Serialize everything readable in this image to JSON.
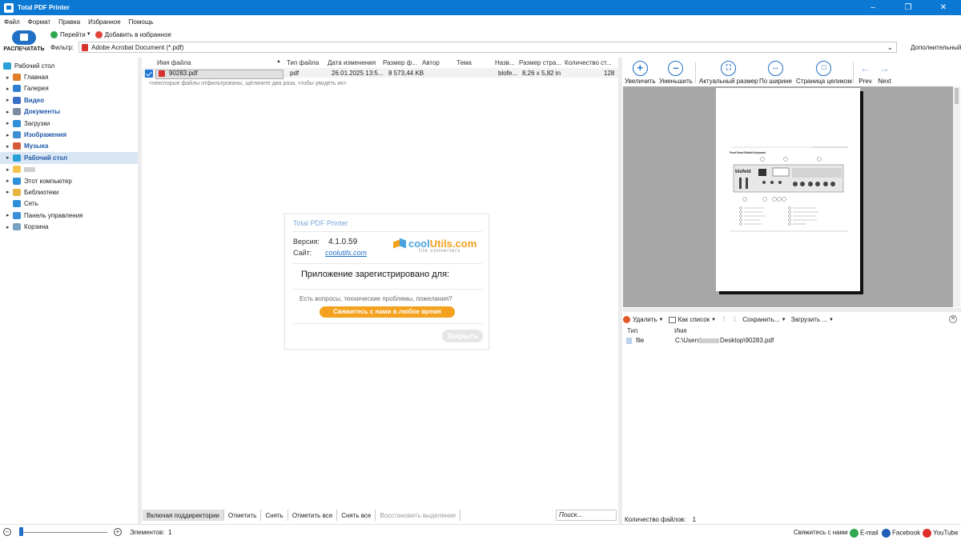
{
  "window": {
    "title": "Total PDF Printer"
  },
  "menu": [
    "Файл",
    "Формат",
    "Правка",
    "Избранное",
    "Помощь"
  ],
  "toolbar": {
    "print_label": "РАСПЕЧАТАТЬ",
    "goto_label": "Перейти",
    "favorite_label": "Добавить в избранное"
  },
  "filter": {
    "label": "Фильтр:",
    "value": "Adobe Acrobat Document (*.pdf)",
    "additional": "Дополнительный"
  },
  "tree": [
    {
      "label": "Рабочий стол",
      "icon": "desktop-icon",
      "color": "#2aa0d8",
      "top": true
    },
    {
      "label": "Главная",
      "icon": "home-icon",
      "color": "#e07b2a"
    },
    {
      "label": "Галерея",
      "icon": "gallery-icon",
      "color": "#2f7fd1"
    },
    {
      "label": "Видео",
      "icon": "video-icon",
      "color": "#3b6fc7",
      "bold": true
    },
    {
      "label": "Документы",
      "icon": "documents-icon",
      "color": "#7a8aa0",
      "bold": true
    },
    {
      "label": "Загрузки",
      "icon": "downloads-icon",
      "color": "#2f8fd8"
    },
    {
      "label": "Изображения",
      "icon": "images-icon",
      "color": "#3e8fd4",
      "bold": true
    },
    {
      "label": "Музыка",
      "icon": "music-icon",
      "color": "#d65a3a",
      "bold": true
    },
    {
      "label": "Рабочий стол",
      "icon": "desktop-icon",
      "color": "#2aa0d8",
      "bold": true,
      "selected": true
    },
    {
      "label": "",
      "icon": "folder-icon",
      "color": "#f3c24b",
      "blurred": true
    },
    {
      "label": "Этот компьютер",
      "icon": "computer-icon",
      "color": "#2f8fd8"
    },
    {
      "label": "Библиотеки",
      "icon": "libraries-icon",
      "color": "#e6b440"
    },
    {
      "label": "Сеть",
      "icon": "network-icon",
      "color": "#2f8fd8",
      "nocaret": true
    },
    {
      "label": "Панель управления",
      "icon": "control-panel-icon",
      "color": "#3b8fd8"
    },
    {
      "label": "Корзина",
      "icon": "recycle-bin-icon",
      "color": "#7aa0c0"
    }
  ],
  "columns": [
    "Имя файла",
    "Тип файла",
    "Дата изменения",
    "Размер ф...",
    "Автор",
    "Тема",
    "Назв...",
    "Размер стра...",
    "Количество ст..."
  ],
  "file": {
    "name": "90283.pdf",
    "type": "pdf",
    "date": "26.01.2025 13:5...",
    "size": "8 573,44 KB",
    "author": "",
    "subject": "",
    "title": "blofe...",
    "pagesize": "8,26 x 5,82 in",
    "pages": "128"
  },
  "note": "<некоторые файлы отфильтрованы, щёлкните два раза, чтобы увидеть их>",
  "bottom": {
    "include": "Включая поддиректории",
    "mark": "Отметить",
    "unmark": "Снять",
    "mark_all": "Отметить все",
    "unmark_all": "Снять все",
    "restore": "Восстановить выделение",
    "search": "Поиск..."
  },
  "about": {
    "title": "Total PDF Printer",
    "version_label": "Версия:",
    "version": "4.1.0.59",
    "site_label": "Сайт:",
    "site": "coolutils.com",
    "logo_a": "cool",
    "logo_b": "Utils.com",
    "logo_sub": "file converters",
    "registered": "Приложение зарегистрировано для:",
    "question": "Есть вопросы, технические проблемы, пожелания?",
    "contact": "Свяжитесь с нами в любое время",
    "close": "Закрыть"
  },
  "preview_toolbar": {
    "zoom_in": "Увеличить",
    "zoom_out": "Уменьшить",
    "actual": "Актуальный размер",
    "width": "По ширине",
    "whole": "Страница целиком",
    "prev": "Prev",
    "next": "Next"
  },
  "preview_page": {
    "header": "Front Panel Blofeld Keyboard",
    "brand": "blofeld"
  },
  "list_toolbar": {
    "delete": "Удалить",
    "as_list": "Как список",
    "save": "Сохранить...",
    "load": "Загрузить ..."
  },
  "list": {
    "col_type": "Тип",
    "col_name": "Имя",
    "row_type": "file",
    "row_name_a": "C:\\Users\\",
    "row_name_b": "Desktop\\90283.pdf"
  },
  "files_count": {
    "label": "Количество файлов:",
    "value": "1"
  },
  "status": {
    "elements_label": "Элементов:",
    "elements": "1",
    "contact": "Свяжитесь с нами",
    "email": "E-mail",
    "facebook": "Facebook",
    "youtube": "YouTube"
  }
}
